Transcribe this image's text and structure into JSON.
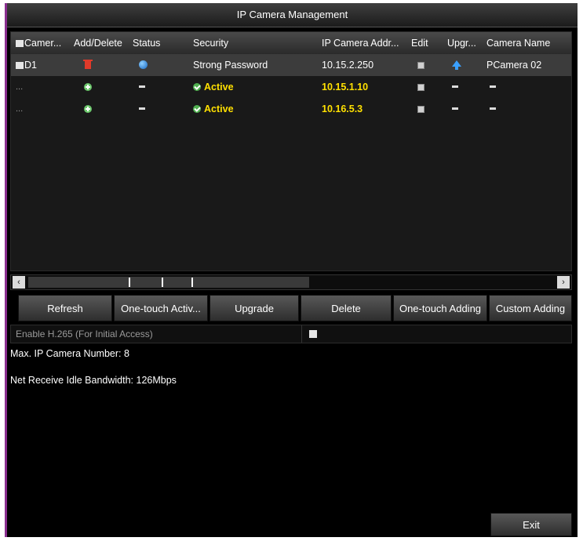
{
  "window": {
    "title": "IP Camera Management"
  },
  "table": {
    "headers": [
      "Camer...",
      "Add/Delete",
      "Status",
      "Security",
      "IP Camera Addr...",
      "Edit",
      "Upgr...",
      "Camera Name"
    ],
    "rows": [
      {
        "camera": "D1",
        "add_delete": "delete-icon",
        "status": "status-icon",
        "security": "Strong Password",
        "ip": "10.15.2.250",
        "edit": "edit-icon",
        "upgrade": "upgrade-icon",
        "name": "PCamera 02"
      },
      {
        "camera": "...",
        "add_delete": "add-icon",
        "status": "-",
        "security": "Active",
        "ip": "10.15.1.10",
        "edit": "edit-icon",
        "upgrade": "-",
        "name": "-"
      },
      {
        "camera": "...",
        "add_delete": "add-icon",
        "status": "-",
        "security": "Active",
        "ip": "10.16.5.3",
        "edit": "edit-icon",
        "upgrade": "-",
        "name": "-"
      }
    ]
  },
  "scrollbar": {
    "left": "‹",
    "right": "›"
  },
  "buttons": {
    "refresh": "Refresh",
    "one_touch_activate": "One-touch Activ...",
    "upgrade": "Upgrade",
    "delete": "Delete",
    "one_touch_adding": "One-touch Adding",
    "custom_adding": "Custom Adding"
  },
  "h265": {
    "label": "Enable H.265 (For Initial Access)"
  },
  "info": {
    "max_cameras": "Max. IP Camera Number: 8",
    "bandwidth": "Net Receive Idle Bandwidth: 126Mbps"
  },
  "exit_label": "Exit",
  "colors": {
    "accent_yellow": "#ffe000",
    "window_border": "#8a2f8f",
    "active_green": "#4fb04f"
  }
}
